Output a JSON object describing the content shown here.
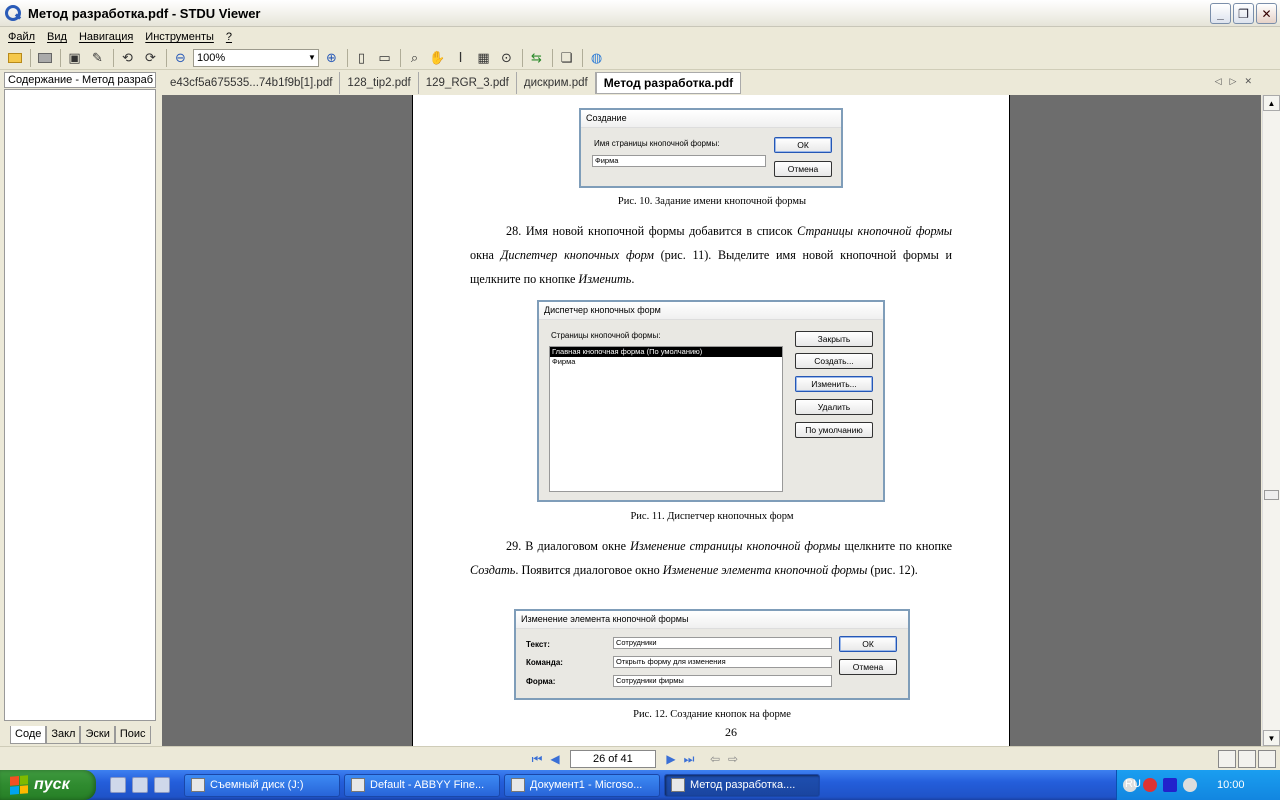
{
  "window": {
    "title": "Метод разработка.pdf - STDU Viewer"
  },
  "menu": [
    "Файл",
    "Вид",
    "Навигация",
    "Инструменты",
    "?"
  ],
  "toolbar": {
    "zoom": "100%"
  },
  "left_panel": {
    "header": "Содержание - Метод разраб",
    "tabs": [
      "Соде",
      "Закл",
      "Эски",
      "Поис"
    ]
  },
  "tabs": [
    {
      "label": "e43cf5a675535...74b1f9b[1].pdf",
      "active": false
    },
    {
      "label": "128_tip2.pdf",
      "active": false
    },
    {
      "label": "129_RGR_3.pdf",
      "active": false
    },
    {
      "label": "дискрим.pdf",
      "active": false
    },
    {
      "label": "Метод разработка.pdf",
      "active": true
    }
  ],
  "page": {
    "dialog1": {
      "title": "Создание",
      "label": "Имя страницы кнопочной формы:",
      "value": "Фирма",
      "ok": "ОК",
      "cancel": "Отмена"
    },
    "caption1": "Рис. 10. Задание имени кнопочной формы",
    "para1_start": "28. Имя новой кнопочной формы добавится в список ",
    "para1_em1": "Страницы кнопочной формы",
    "para1_mid": " окна ",
    "para1_em2": "Диспетчер кнопочных форм",
    "para1_rest": " (рис. 11). Выделите имя новой кнопочной формы и щелкните по кнопке ",
    "para1_em3": "Изменить",
    "para1_end": ".",
    "dialog2": {
      "title": "Диспетчер кнопочных форм",
      "label": "Страницы кнопочной формы:",
      "items": [
        "Главная кнопочная форма (По умолчанию)",
        "Фирма"
      ],
      "buttons": [
        "Закрыть",
        "Создать...",
        "Изменить...",
        "Удалить",
        "По умолчанию"
      ]
    },
    "caption2": "Рис. 11. Диспетчер кнопочных форм",
    "para2_start": "29. В диалоговом окне ",
    "para2_em1": "Изменение страницы кнопочной формы",
    "para2_mid1": " щелкните по кнопке ",
    "para2_em2": "Создать",
    "para2_mid2": ". Появится диалоговое окно ",
    "para2_em3": "Изменение элемента кнопочной формы",
    "para2_end": " (рис. 12).",
    "dialog3": {
      "title": "Изменение элемента кнопочной формы",
      "rows": [
        {
          "label": "Текст:",
          "value": "Сотрудники"
        },
        {
          "label": "Команда:",
          "value": "Открыть форму для изменения"
        },
        {
          "label": "Форма:",
          "value": "Сотрудники фирмы"
        }
      ],
      "ok": "ОК",
      "cancel": "Отмена"
    },
    "caption3": "Рис. 12. Создание кнопок на форме",
    "number": "26"
  },
  "navbar": {
    "page_indicator": "26 of 41"
  },
  "taskbar": {
    "start": "пуск",
    "tasks": [
      {
        "label": "Съемный диск (J:)",
        "active": false
      },
      {
        "label": "Default - ABBYY Fine...",
        "active": false
      },
      {
        "label": "Документ1 - Microso...",
        "active": false
      },
      {
        "label": "Метод разработка....",
        "active": true
      }
    ],
    "lang": "RU",
    "clock": "10:00"
  }
}
